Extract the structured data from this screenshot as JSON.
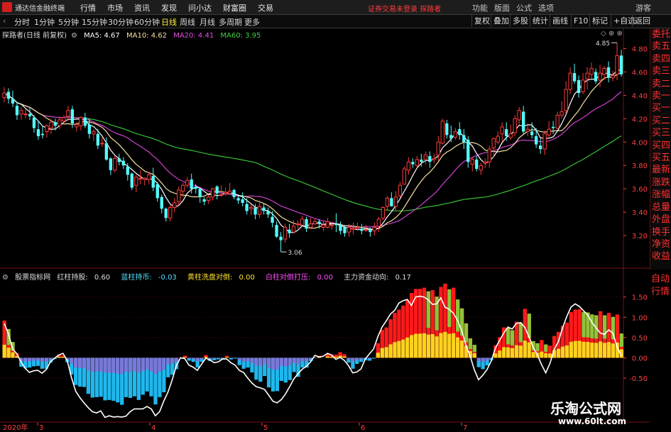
{
  "app": {
    "title": "通达信金融终端",
    "menu": [
      "行情",
      "市场",
      "资讯",
      "发现",
      "问小达",
      "财富圈",
      "交易"
    ],
    "notice": "证券交易未登录",
    "notice2": "探路者",
    "right_menu": [
      "功能",
      "版面",
      "公式",
      "选项"
    ],
    "guest": "游客"
  },
  "toolbar": {
    "timeframes": [
      "分时",
      "1分钟",
      "5分钟",
      "15分钟",
      "30分钟",
      "60分钟",
      "日线",
      "周线",
      "月线",
      "多周期",
      "更多"
    ],
    "active": "日线",
    "right_buttons": [
      "复权",
      "叠加",
      "多股",
      "统计",
      "画线",
      "F10",
      "标记",
      "+自选",
      "返回"
    ]
  },
  "main_legend": {
    "name": "探路者(日线 前复权)",
    "ma5": "MA5: 4.67",
    "ma10": "MA10: 4.62",
    "ma20": "MA20: 4.41",
    "ma60": "MA60: 3.95"
  },
  "colors": {
    "up": "#ff3a3a",
    "down": "#54ffff",
    "ma5": "#ffffff",
    "ma10": "#f5e1a0",
    "ma20": "#d040d0",
    "ma60": "#38c038",
    "grid": "#7a1010",
    "axis": "#ff4040"
  },
  "price_axis": [
    "4.80",
    "4.60",
    "4.40",
    "4.20",
    "4.00",
    "3.80",
    "3.60",
    "3.40",
    "3.20"
  ],
  "price_high_label": "4.85",
  "price_low_label": "3.06",
  "candles": [
    [
      4.38,
      4.42,
      4.47,
      4.34
    ],
    [
      4.43,
      4.37,
      4.46,
      4.33
    ],
    [
      4.37,
      4.33,
      4.44,
      4.3
    ],
    [
      4.31,
      4.23,
      4.34,
      4.19
    ],
    [
      4.24,
      4.27,
      4.3,
      4.19
    ],
    [
      4.24,
      4.24,
      4.29,
      4.2
    ],
    [
      4.24,
      4.22,
      4.3,
      4.19
    ],
    [
      4.21,
      4.12,
      4.23,
      4.08
    ],
    [
      4.11,
      4.05,
      4.18,
      4.02
    ],
    [
      4.07,
      4.06,
      4.14,
      4.03
    ],
    [
      4.09,
      4.14,
      4.15,
      4.04
    ],
    [
      4.12,
      4.17,
      4.2,
      4.07
    ],
    [
      4.17,
      4.14,
      4.2,
      4.1
    ],
    [
      4.14,
      4.19,
      4.22,
      4.11
    ],
    [
      4.18,
      4.21,
      4.23,
      4.15
    ],
    [
      4.22,
      4.27,
      4.31,
      4.18
    ],
    [
      4.28,
      4.16,
      4.31,
      4.12
    ],
    [
      4.13,
      4.15,
      4.17,
      4.09
    ],
    [
      4.14,
      4.21,
      4.22,
      4.1
    ],
    [
      4.21,
      4.14,
      4.25,
      4.12
    ],
    [
      4.15,
      4.07,
      4.2,
      4.03
    ],
    [
      4.07,
      4.09,
      4.11,
      4.01
    ],
    [
      4.07,
      3.97,
      4.11,
      3.94
    ],
    [
      3.99,
      3.99,
      4.04,
      3.96
    ],
    [
      3.99,
      3.85,
      4.04,
      3.84
    ],
    [
      3.86,
      3.76,
      3.87,
      3.72
    ],
    [
      3.76,
      3.86,
      3.88,
      3.74
    ],
    [
      3.86,
      3.83,
      3.9,
      3.8
    ],
    [
      3.84,
      3.8,
      3.87,
      3.77
    ],
    [
      3.79,
      3.72,
      3.82,
      3.67
    ],
    [
      3.73,
      3.61,
      3.74,
      3.59
    ],
    [
      3.63,
      3.7,
      3.72,
      3.57
    ],
    [
      3.69,
      3.69,
      3.76,
      3.64
    ],
    [
      3.68,
      3.69,
      3.7,
      3.63
    ],
    [
      3.68,
      3.72,
      3.74,
      3.64
    ],
    [
      3.71,
      3.61,
      3.78,
      3.58
    ],
    [
      3.64,
      3.52,
      3.66,
      3.49
    ],
    [
      3.53,
      3.43,
      3.55,
      3.39
    ],
    [
      3.43,
      3.35,
      3.44,
      3.32
    ],
    [
      3.35,
      3.44,
      3.46,
      3.32
    ],
    [
      3.44,
      3.48,
      3.52,
      3.4
    ],
    [
      3.49,
      3.59,
      3.62,
      3.46
    ],
    [
      3.58,
      3.63,
      3.65,
      3.53
    ],
    [
      3.63,
      3.67,
      3.7,
      3.61
    ],
    [
      3.68,
      3.6,
      3.73,
      3.56
    ],
    [
      3.62,
      3.6,
      3.64,
      3.56
    ],
    [
      3.6,
      3.53,
      3.61,
      3.48
    ],
    [
      3.51,
      3.49,
      3.53,
      3.46
    ],
    [
      3.5,
      3.53,
      3.55,
      3.47
    ],
    [
      3.53,
      3.6,
      3.61,
      3.5
    ],
    [
      3.62,
      3.56,
      3.63,
      3.51
    ],
    [
      3.55,
      3.55,
      3.63,
      3.53
    ],
    [
      3.56,
      3.57,
      3.61,
      3.54
    ],
    [
      3.56,
      3.58,
      3.65,
      3.55
    ],
    [
      3.59,
      3.53,
      3.6,
      3.51
    ],
    [
      3.52,
      3.5,
      3.54,
      3.47
    ],
    [
      3.51,
      3.48,
      3.57,
      3.45
    ],
    [
      3.47,
      3.41,
      3.52,
      3.38
    ],
    [
      3.43,
      3.44,
      3.47,
      3.38
    ],
    [
      3.44,
      3.38,
      3.47,
      3.34
    ],
    [
      3.38,
      3.45,
      3.5,
      3.35
    ],
    [
      3.44,
      3.41,
      3.47,
      3.38
    ],
    [
      3.41,
      3.38,
      3.44,
      3.35
    ],
    [
      3.36,
      3.31,
      3.41,
      3.27
    ],
    [
      3.29,
      3.19,
      3.32,
      3.18
    ],
    [
      3.19,
      3.16,
      3.23,
      3.06
    ],
    [
      3.17,
      3.27,
      3.3,
      3.14
    ],
    [
      3.25,
      3.22,
      3.3,
      3.18
    ],
    [
      3.23,
      3.28,
      3.33,
      3.22
    ],
    [
      3.3,
      3.3,
      3.33,
      3.26
    ],
    [
      3.29,
      3.34,
      3.37,
      3.29
    ],
    [
      3.34,
      3.26,
      3.36,
      3.23
    ],
    [
      3.27,
      3.3,
      3.35,
      3.26
    ],
    [
      3.3,
      3.32,
      3.34,
      3.29
    ],
    [
      3.32,
      3.3,
      3.34,
      3.26
    ],
    [
      3.27,
      3.29,
      3.32,
      3.24
    ],
    [
      3.27,
      3.32,
      3.35,
      3.26
    ],
    [
      3.29,
      3.29,
      3.32,
      3.25
    ],
    [
      3.3,
      3.29,
      3.39,
      3.23
    ],
    [
      3.29,
      3.24,
      3.32,
      3.21
    ],
    [
      3.27,
      3.22,
      3.29,
      3.19
    ],
    [
      3.23,
      3.27,
      3.3,
      3.19
    ],
    [
      3.26,
      3.26,
      3.31,
      3.21
    ],
    [
      3.26,
      3.27,
      3.31,
      3.24
    ],
    [
      3.26,
      3.24,
      3.3,
      3.21
    ],
    [
      3.25,
      3.25,
      3.29,
      3.23
    ],
    [
      3.25,
      3.23,
      3.27,
      3.19
    ],
    [
      3.24,
      3.27,
      3.31,
      3.2
    ],
    [
      3.28,
      3.34,
      3.36,
      3.23
    ],
    [
      3.35,
      3.44,
      3.45,
      3.33
    ],
    [
      3.45,
      3.52,
      3.54,
      3.42
    ],
    [
      3.52,
      3.45,
      3.57,
      3.45
    ],
    [
      3.45,
      3.53,
      3.58,
      3.41
    ],
    [
      3.54,
      3.63,
      3.66,
      3.52
    ],
    [
      3.64,
      3.77,
      3.79,
      3.64
    ],
    [
      3.76,
      3.83,
      3.87,
      3.72
    ],
    [
      3.83,
      3.81,
      3.86,
      3.78
    ],
    [
      3.8,
      3.85,
      3.88,
      3.78
    ],
    [
      3.85,
      3.83,
      3.9,
      3.79
    ],
    [
      3.85,
      3.89,
      3.92,
      3.81
    ],
    [
      3.88,
      3.83,
      3.92,
      3.78
    ],
    [
      3.85,
      3.86,
      3.9,
      3.82
    ],
    [
      3.89,
      4.0,
      4.05,
      3.84
    ],
    [
      3.99,
      4.18,
      4.2,
      3.98
    ],
    [
      4.16,
      4.06,
      4.19,
      4.03
    ],
    [
      4.06,
      4.03,
      4.14,
      4.0
    ],
    [
      4.04,
      4.09,
      4.12,
      4.02
    ],
    [
      4.11,
      4.06,
      4.17,
      4.02
    ],
    [
      4.06,
      4.0,
      4.11,
      3.94
    ],
    [
      4.02,
      3.83,
      4.05,
      3.78
    ],
    [
      3.81,
      3.85,
      3.87,
      3.75
    ],
    [
      3.85,
      3.77,
      3.88,
      3.75
    ],
    [
      3.76,
      3.8,
      3.82,
      3.72
    ],
    [
      3.82,
      3.83,
      3.86,
      3.78
    ],
    [
      3.83,
      3.94,
      3.97,
      3.78
    ],
    [
      3.95,
      4.03,
      4.04,
      3.87
    ],
    [
      4.0,
      4.05,
      4.09,
      3.98
    ],
    [
      4.07,
      4.13,
      4.17,
      4.0
    ],
    [
      4.11,
      4.05,
      4.17,
      4.01
    ],
    [
      4.04,
      4.07,
      4.15,
      4.02
    ],
    [
      4.08,
      4.2,
      4.23,
      4.05
    ],
    [
      4.19,
      4.27,
      4.3,
      4.15
    ],
    [
      4.26,
      4.09,
      4.31,
      4.06
    ],
    [
      4.09,
      4.11,
      4.16,
      4.05
    ],
    [
      4.09,
      4.06,
      4.17,
      4.03
    ],
    [
      4.05,
      3.98,
      4.12,
      3.95
    ],
    [
      3.97,
      3.94,
      4.03,
      3.9
    ],
    [
      3.94,
      4.07,
      4.1,
      3.89
    ],
    [
      4.06,
      4.11,
      4.18,
      4.03
    ],
    [
      4.13,
      4.12,
      4.18,
      4.07
    ],
    [
      4.12,
      4.23,
      4.26,
      4.11
    ],
    [
      4.23,
      4.26,
      4.35,
      4.2
    ],
    [
      4.27,
      4.45,
      4.52,
      4.24
    ],
    [
      4.45,
      4.59,
      4.64,
      4.41
    ],
    [
      4.59,
      4.52,
      4.67,
      4.5
    ],
    [
      4.53,
      4.42,
      4.57,
      4.38
    ],
    [
      4.43,
      4.53,
      4.59,
      4.41
    ],
    [
      4.54,
      4.59,
      4.64,
      4.45
    ],
    [
      4.58,
      4.63,
      4.68,
      4.54
    ],
    [
      4.6,
      4.52,
      4.63,
      4.5
    ],
    [
      4.53,
      4.59,
      4.66,
      4.47
    ],
    [
      4.58,
      4.63,
      4.65,
      4.53
    ],
    [
      4.64,
      4.55,
      4.69,
      4.51
    ],
    [
      4.55,
      4.57,
      4.61,
      4.52
    ],
    [
      4.58,
      4.74,
      4.85,
      4.53
    ],
    [
      4.74,
      4.58,
      4.79,
      4.56
    ]
  ],
  "indicator": {
    "name": "股票指标网",
    "red_label": "红柱持股:",
    "red_value": "0.60",
    "blue_label": "蓝柱持币:",
    "blue_value": "-0.03",
    "yellow_label": "黄柱洗盘对倒:",
    "yellow_value": "0.00",
    "white_label": "白柱对倒打压:",
    "white_value": "0.00",
    "main_label": "主力资金动向:",
    "main_value": "0.17",
    "axis": [
      "1.50",
      "1.00",
      "0.50",
      "0.00",
      "-0.50"
    ],
    "bars": [
      0.92,
      0.71,
      0.39,
      0.12,
      -0.22,
      -0.26,
      -0.24,
      -0.21,
      -0.2,
      -0.27,
      -0.27,
      -0.12,
      -0.03,
      0.08,
      0.06,
      -0.11,
      -0.41,
      -0.67,
      -0.71,
      -0.72,
      -0.89,
      -0.98,
      -0.97,
      -0.96,
      -1.05,
      -1.04,
      -1.06,
      -1.1,
      -1.16,
      -0.97,
      -0.99,
      -0.95,
      -1.04,
      -0.91,
      -0.83,
      -0.95,
      -1.15,
      -0.97,
      -0.85,
      -0.48,
      -0.42,
      -0.28,
      0.01,
      0.05,
      -0.07,
      -0.1,
      -0.24,
      -0.1,
      0.07,
      -0.08,
      -0.06,
      -0.04,
      -0.04,
      0.05,
      -0.04,
      -0.02,
      -0.18,
      -0.27,
      -0.24,
      -0.36,
      -0.54,
      -0.59,
      -0.45,
      -0.73,
      -0.83,
      -0.82,
      -0.57,
      -0.61,
      -0.55,
      -0.35,
      -0.47,
      -0.24,
      -0.24,
      -0.08,
      -0.01,
      0.05,
      0.0,
      0.1,
      0.08,
      0.08,
      0.14,
      0.09,
      -0.12,
      -0.27,
      -0.15,
      -0.1,
      -0.06,
      -0.07,
      -0.02,
      0.36,
      0.69,
      0.75,
      0.95,
      1.11,
      1.19,
      1.29,
      1.43,
      1.6,
      1.7,
      1.7,
      1.73,
      1.64,
      1.67,
      1.51,
      1.75,
      1.83,
      1.69,
      1.73,
      1.44,
      1.22,
      0.85,
      0.48,
      0.32,
      -0.23,
      -0.28,
      -0.19,
      -0.06,
      0.31,
      0.51,
      0.75,
      0.74,
      0.68,
      0.89,
      0.86,
      1.21,
      1.09,
      0.41,
      0.36,
      0.44,
      0.33,
      0.3,
      0.54,
      0.64,
      0.79,
      0.87,
      1.13,
      1.19,
      1.2,
      1.13,
      1.12,
      1.07,
      1.05,
      1.15,
      1.05,
      1.11,
      1.01,
      1.07,
      0.6
    ],
    "line": [
      0.85,
      0.59,
      0.22,
      0.1,
      -0.1,
      -0.26,
      -0.36,
      -0.32,
      -0.31,
      -0.38,
      -0.29,
      -0.1,
      -0.01,
      0.07,
      0.11,
      -0.06,
      -0.48,
      -0.82,
      -0.98,
      -1.11,
      -1.23,
      -1.33,
      -1.36,
      -1.31,
      -1.47,
      -1.43,
      -1.46,
      -1.45,
      -1.46,
      -1.44,
      -1.33,
      -1.26,
      -1.26,
      -1.26,
      -1.2,
      -1.26,
      -1.43,
      -1.33,
      -1.07,
      -0.85,
      -0.55,
      -0.19,
      0.0,
      -0.02,
      -0.18,
      -0.23,
      -0.31,
      -0.16,
      -0.01,
      -0.05,
      -0.12,
      -0.1,
      -0.03,
      -0.03,
      -0.12,
      -0.18,
      -0.31,
      -0.36,
      -0.5,
      -0.62,
      -0.71,
      -0.74,
      -0.78,
      -0.92,
      -1.07,
      -1.11,
      -1.03,
      -0.89,
      -0.71,
      -0.52,
      -0.39,
      -0.28,
      -0.21,
      -0.1,
      0.06,
      0.02,
      0.04,
      0.11,
      0.07,
      -0.04,
      0.01,
      -0.06,
      -0.19,
      -0.37,
      -0.35,
      -0.27,
      -0.03,
      0.1,
      0.22,
      0.52,
      0.76,
      0.91,
      1.08,
      1.17,
      1.35,
      1.41,
      1.44,
      1.29,
      1.5,
      1.52,
      1.5,
      1.43,
      1.32,
      1.33,
      1.48,
      1.25,
      1.2,
      1.1,
      0.92,
      0.66,
      0.3,
      0.04,
      -0.3,
      -0.54,
      -0.43,
      -0.29,
      -0.08,
      0.24,
      0.43,
      0.61,
      0.76,
      0.71,
      0.85,
      0.87,
      0.75,
      0.52,
      0.26,
      0.07,
      -0.17,
      -0.37,
      -0.14,
      0.2,
      0.4,
      0.74,
      1.02,
      1.25,
      1.33,
      1.27,
      1.16,
      1.06,
      0.87,
      0.74,
      0.61,
      0.58,
      0.69,
      0.61,
      0.27,
      0.05
    ]
  },
  "dates": {
    "year": "2020年",
    "months": [
      "3",
      "4",
      "5",
      "6",
      "7"
    ]
  },
  "watermark": {
    "cn": "乐淘公式网",
    "url": "www.60lt.com"
  },
  "side_panel": [
    "委托",
    "卖五",
    "卖四",
    "卖三",
    "卖二",
    "卖一",
    "买一",
    "买二",
    "买三",
    "买四",
    "买五",
    "最新",
    "涨跌",
    "涨幅",
    "总量",
    "外盘",
    "换手",
    "净资",
    "收益"
  ],
  "side_panel2": [
    "自动",
    "行情"
  ]
}
